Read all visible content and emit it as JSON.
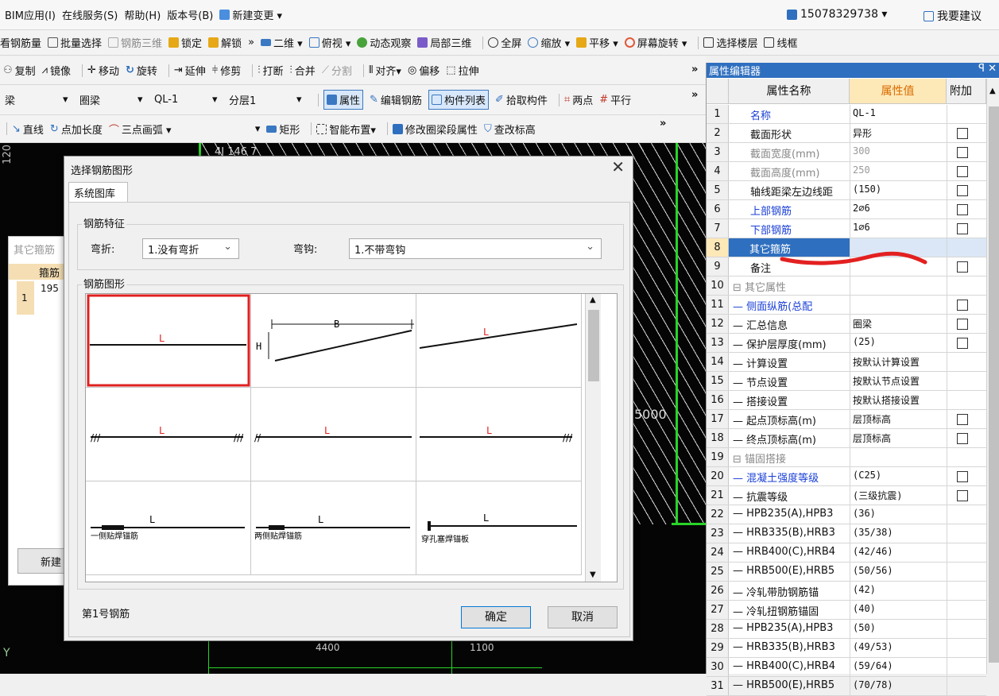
{
  "menu": {
    "items": [
      "BIM应用(I)",
      "在线服务(S)",
      "帮助(H)",
      "版本号(B)",
      "新建变更 ▾"
    ],
    "phone": "15078329738 ▾",
    "feedback": "我要建议"
  },
  "toolbar1": [
    "看钢筋量",
    "批量选择",
    "钢筋三维",
    "锁定",
    "解锁",
    "»",
    "二维 ▾",
    "俯视 ▾",
    "动态观察",
    "局部三维",
    "全屏",
    "缩放 ▾",
    "平移 ▾",
    "屏幕旋转 ▾",
    "选择楼层",
    "线框"
  ],
  "toolbar2": [
    "复制",
    "镜像",
    "移动",
    "旋转",
    "延伸",
    "修剪",
    "打断",
    "合并",
    "分割",
    "对齐▾",
    "偏移",
    "拉伸",
    "»"
  ],
  "toolbar3": {
    "type": "梁",
    "subtype": "圈梁",
    "name": "QL-1",
    "layer": "分层1",
    "buttons": [
      "属性",
      "编辑钢筋",
      "构件列表",
      "拾取构件",
      "两点",
      "平行",
      "»"
    ]
  },
  "toolbar4": [
    "直线",
    "点加长度",
    "三点画弧 ▾",
    "矩形",
    "智能布置▾",
    "修改圈梁段属性",
    "查改标高",
    "»"
  ],
  "cad": {
    "left_num": "120",
    "dim1": "4400",
    "dim2": "1100",
    "dim3": "5000",
    "axis": "Y",
    "top_label": "4J 146 7"
  },
  "left_panel": {
    "title": "其它箍筋",
    "col": "箍筋",
    "row_no": "1",
    "row_val": "195",
    "new_btn": "新建"
  },
  "dialog": {
    "title": "选择钢筋图形",
    "tab": "系统图库",
    "group1": "钢筋特征",
    "bend_label": "弯折:",
    "bend_value": "1.没有弯折",
    "hook_label": "弯钩:",
    "hook_value": "1.不带弯钩",
    "group2": "钢筋图形",
    "status": "第1号钢筋",
    "ok": "确定",
    "cancel": "取消",
    "shapes": {
      "L": "L",
      "B": "B",
      "H": "H",
      "t1": "一侧贴焊锚筋",
      "t2": "两侧贴焊锚筋",
      "t3": "穿孔塞焊锚板"
    }
  },
  "props": {
    "title": "属性编辑器",
    "pin": "ꟼ ✕",
    "headers": [
      "属性名称",
      "属性值",
      "附加"
    ],
    "rows": [
      {
        "n": "1",
        "name": "名称",
        "val": "QL-1",
        "cb": false,
        "color": "#1a3fd6"
      },
      {
        "n": "2",
        "name": "截面形状",
        "val": "异形",
        "cb": true,
        "color": "#111"
      },
      {
        "n": "3",
        "name": "截面宽度(mm)",
        "val": "300",
        "cb": true,
        "color": "#888"
      },
      {
        "n": "4",
        "name": "截面高度(mm)",
        "val": "250",
        "cb": true,
        "color": "#888"
      },
      {
        "n": "5",
        "name": "轴线距梁左边线距",
        "val": "(150)",
        "cb": true,
        "color": "#111"
      },
      {
        "n": "6",
        "name": "上部钢筋",
        "val": "2⌀6",
        "cb": true,
        "color": "#1a3fd6"
      },
      {
        "n": "7",
        "name": "下部钢筋",
        "val": "1⌀6",
        "cb": true,
        "color": "#1a3fd6"
      },
      {
        "n": "8",
        "name": "其它箍筋",
        "val": "",
        "cb": false,
        "color": "#fff"
      },
      {
        "n": "9",
        "name": "备注",
        "val": "",
        "cb": true,
        "color": "#111"
      },
      {
        "n": "10",
        "name": "⊟ 其它属性",
        "val": "",
        "cb": false,
        "color": "#888"
      },
      {
        "n": "11",
        "name": "— 侧面纵筋(总配",
        "val": "",
        "cb": true,
        "color": "#1a3fd6"
      },
      {
        "n": "12",
        "name": "— 汇总信息",
        "val": "圈梁",
        "cb": true,
        "color": "#111"
      },
      {
        "n": "13",
        "name": "— 保护层厚度(mm)",
        "val": "(25)",
        "cb": true,
        "color": "#111"
      },
      {
        "n": "14",
        "name": "— 计算设置",
        "val": "按默认计算设置",
        "cb": false,
        "color": "#111"
      },
      {
        "n": "15",
        "name": "— 节点设置",
        "val": "按默认节点设置",
        "cb": false,
        "color": "#111"
      },
      {
        "n": "16",
        "name": "— 搭接设置",
        "val": "按默认搭接设置",
        "cb": false,
        "color": "#111"
      },
      {
        "n": "17",
        "name": "— 起点顶标高(m)",
        "val": "层顶标高",
        "cb": true,
        "color": "#111"
      },
      {
        "n": "18",
        "name": "— 终点顶标高(m)",
        "val": "层顶标高",
        "cb": true,
        "color": "#111"
      },
      {
        "n": "19",
        "name": "⊟ 锚固搭接",
        "val": "",
        "cb": false,
        "color": "#888"
      },
      {
        "n": "20",
        "name": "— 混凝土强度等级",
        "val": "(C25)",
        "cb": true,
        "color": "#1a3fd6"
      },
      {
        "n": "21",
        "name": "— 抗震等级",
        "val": "(三级抗震)",
        "cb": true,
        "color": "#111"
      },
      {
        "n": "22",
        "name": "— HPB235(A),HPB3",
        "val": "(36)",
        "cb": false,
        "color": "#111"
      },
      {
        "n": "23",
        "name": "— HRB335(B),HRB3",
        "val": "(35/38)",
        "cb": false,
        "color": "#111"
      },
      {
        "n": "24",
        "name": "— HRB400(C),HRB4",
        "val": "(42/46)",
        "cb": false,
        "color": "#111"
      },
      {
        "n": "25",
        "name": "— HRB500(E),HRB5",
        "val": "(50/56)",
        "cb": false,
        "color": "#111"
      },
      {
        "n": "26",
        "name": "— 冷轧带肋钢筋锚",
        "val": "(42)",
        "cb": false,
        "color": "#111"
      },
      {
        "n": "27",
        "name": "— 冷轧扭钢筋锚固",
        "val": "(40)",
        "cb": false,
        "color": "#111"
      },
      {
        "n": "28",
        "name": "— HPB235(A),HPB3",
        "val": "(50)",
        "cb": false,
        "color": "#111"
      },
      {
        "n": "29",
        "name": "— HRB335(B),HRB3",
        "val": "(49/53)",
        "cb": false,
        "color": "#111"
      },
      {
        "n": "30",
        "name": "— HRB400(C),HRB4",
        "val": "(59/64)",
        "cb": false,
        "color": "#111"
      },
      {
        "n": "31",
        "name": "— HRB500(E),HRB5",
        "val": "(70/78)",
        "cb": false,
        "color": "#111"
      }
    ]
  }
}
